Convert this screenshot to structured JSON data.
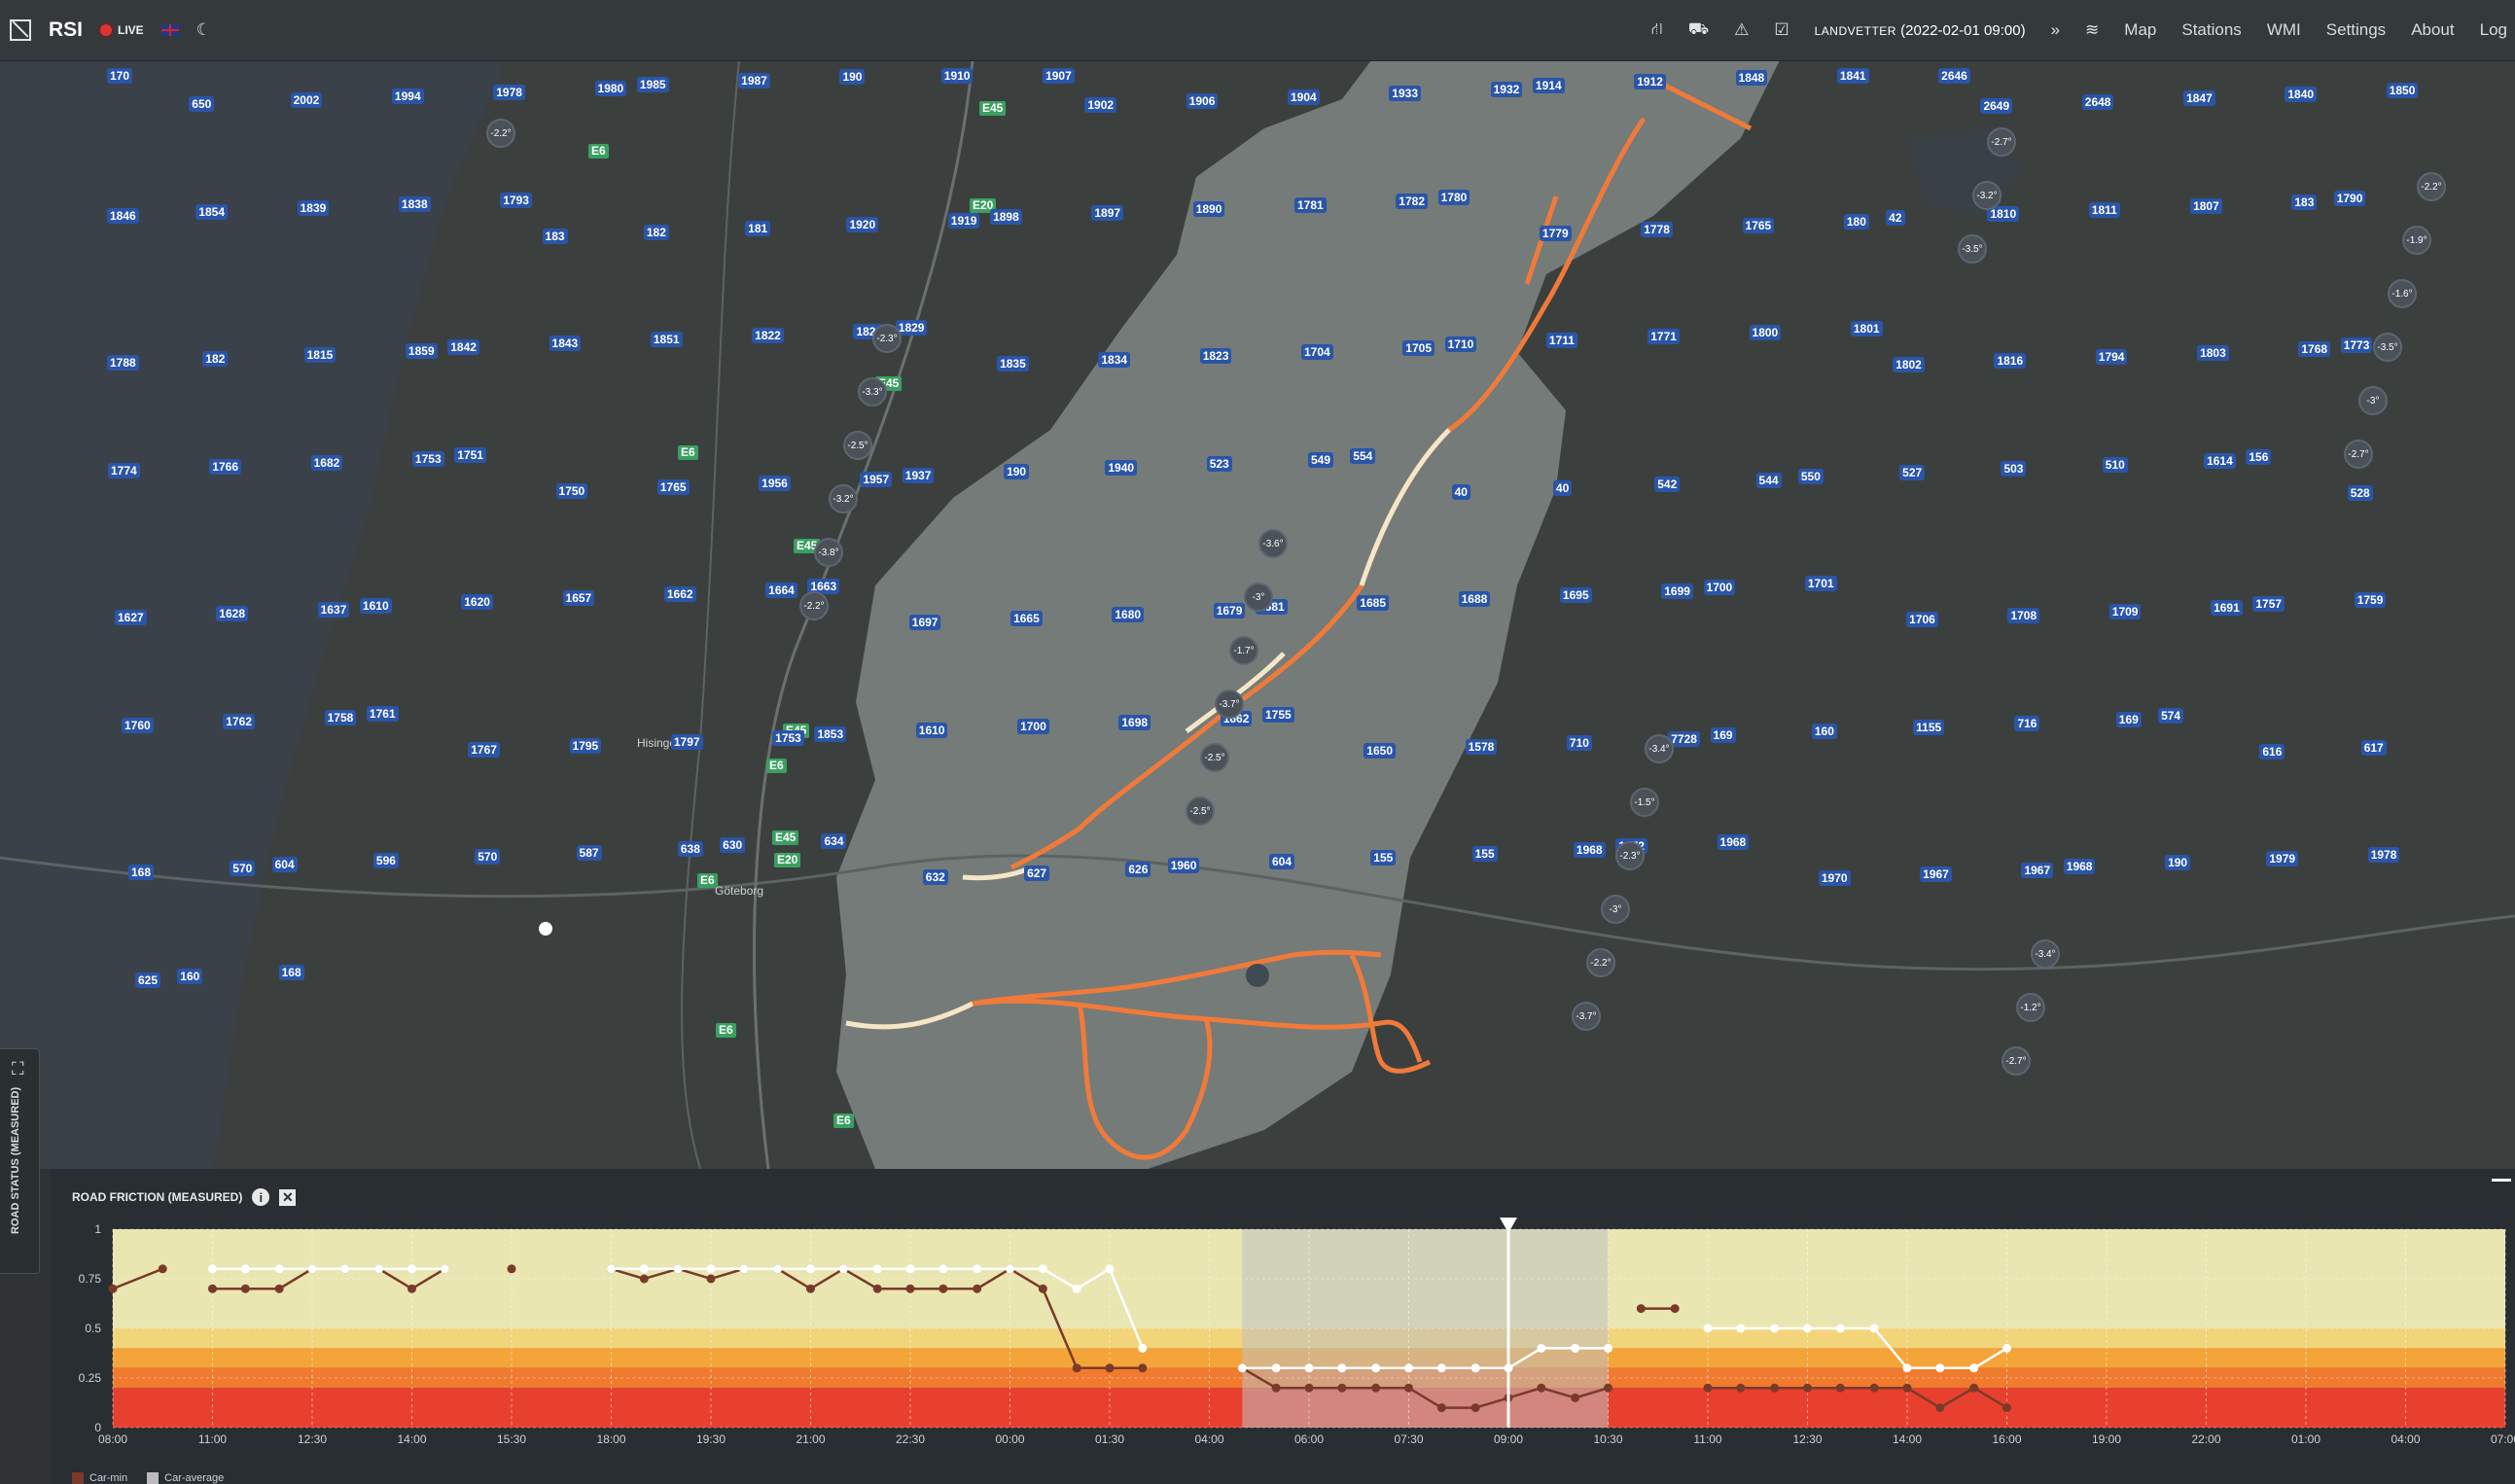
{
  "app": {
    "logo": "RSI",
    "live_label": "LIVE",
    "language": "English",
    "station": "LANDVETTER",
    "datetime": "(2022-02-01 09:00)",
    "nav": [
      "Map",
      "Stations",
      "WMI",
      "Settings",
      "About",
      "Log"
    ]
  },
  "icons": {
    "theme": "moon-icon",
    "road": "road-icon",
    "car": "car-icon",
    "warning": "warning-icon",
    "calendar": "calendar-icon",
    "forward": "chevrons-right-icon",
    "layers": "layers-icon"
  },
  "map": {
    "places": [
      "Hisingen",
      "Göteborg"
    ],
    "roads": [
      "E45",
      "E6",
      "E20",
      "E45",
      "E6",
      "E45",
      "E45",
      "E6",
      "E6",
      "E45",
      "E20",
      "E6",
      "E6"
    ],
    "station_labels": [
      "170",
      "650",
      "2002",
      "1994",
      "1978",
      "1980",
      "1985",
      "1987",
      "190",
      "1910",
      "1907",
      "1902",
      "1906",
      "1904",
      "1933",
      "1932",
      "1914",
      "1912",
      "1848",
      "1841",
      "2646",
      "2649",
      "2648",
      "1847",
      "1840",
      "1850",
      "1846",
      "1854",
      "1839",
      "1838",
      "1793",
      "183",
      "182",
      "181",
      "1920",
      "1919",
      "1898",
      "1897",
      "1890",
      "1781",
      "1782",
      "1780",
      "1779",
      "1778",
      "1765",
      "180",
      "42",
      "1810",
      "1811",
      "1807",
      "183",
      "1790",
      "1788",
      "182",
      "1815",
      "1859",
      "1842",
      "1843",
      "1851",
      "1822",
      "1824",
      "1829",
      "1835",
      "1834",
      "1823",
      "1704",
      "1705",
      "1710",
      "1711",
      "1771",
      "1800",
      "1801",
      "1802",
      "1816",
      "1794",
      "1803",
      "1768",
      "1773",
      "1774",
      "1766",
      "1682",
      "1753",
      "1751",
      "1750",
      "1765",
      "1956",
      "1957",
      "1937",
      "190",
      "1940",
      "523",
      "549",
      "554",
      "40",
      "40",
      "542",
      "544",
      "550",
      "527",
      "503",
      "510",
      "1614",
      "156",
      "528",
      "1627",
      "1628",
      "1637",
      "1610",
      "1620",
      "1657",
      "1662",
      "1664",
      "1663",
      "1697",
      "1665",
      "1680",
      "1679",
      "1681",
      "1685",
      "1688",
      "1695",
      "1699",
      "1700",
      "1701",
      "1706",
      "1708",
      "1709",
      "1691",
      "1757",
      "1759",
      "1760",
      "1762",
      "1758",
      "1761",
      "1767",
      "1795",
      "1797",
      "1753",
      "1853",
      "1610",
      "1700",
      "1698",
      "1662",
      "1755",
      "1650",
      "1578",
      "710",
      "7728",
      "169",
      "160",
      "1155",
      "716",
      "169",
      "574",
      "616",
      "617",
      "168",
      "570",
      "604",
      "596",
      "570",
      "587",
      "638",
      "630",
      "634",
      "632",
      "627",
      "626",
      "1960",
      "604",
      "155",
      "155",
      "1968",
      "1972",
      "1968",
      "1970",
      "1967",
      "1967",
      "1968",
      "190",
      "1979",
      "1978",
      "625",
      "160",
      "168"
    ],
    "temperatures": [
      "-2.2°",
      "-2.3°",
      "-3.6°",
      "-3.4°",
      "-3.4°",
      "-2.2°",
      "-3.3°",
      "-3°",
      "-1.5°",
      "-1.2°",
      "-1.9°",
      "-2.5°",
      "-1.7°",
      "-2.3°",
      "-2.7°",
      "-1.6°",
      "-3.2°",
      "-3.7°",
      "-3°",
      "-2.7°",
      "-3.5°",
      "-3.8°",
      "-2.5°",
      "-2.2°",
      "-3.2°",
      "-3°",
      "-2.2°",
      "-2.5°",
      "-3.7°",
      "-3.5°",
      "-2.7°"
    ]
  },
  "side_panel": {
    "label": "ROAD STATUS (MEASURED)"
  },
  "chart_panel": {
    "title": "ROAD FRICTION (MEASURED)",
    "legend": [
      "Car-min",
      "Car-average"
    ]
  },
  "chart_data": {
    "type": "line",
    "title": "ROAD FRICTION (MEASURED)",
    "x_ticks": [
      "08:00",
      "11:00",
      "12:30",
      "14:00",
      "15:30",
      "18:00",
      "19:30",
      "21:00",
      "22:30",
      "00:00",
      "01:30",
      "04:00",
      "06:00",
      "07:30",
      "09:00",
      "10:30",
      "11:00",
      "12:30",
      "14:00",
      "16:00",
      "19:00",
      "22:00",
      "01:00",
      "04:00",
      "07:00"
    ],
    "y_ticks": [
      "0",
      "0.25",
      "0.5",
      "0.75",
      "1"
    ],
    "ylim": [
      0,
      1
    ],
    "bands": [
      {
        "from": 0,
        "to": 0.2,
        "color": "#e8402e"
      },
      {
        "from": 0.2,
        "to": 0.3,
        "color": "#f07a2e"
      },
      {
        "from": 0.3,
        "to": 0.4,
        "color": "#f5a43a"
      },
      {
        "from": 0.4,
        "to": 0.5,
        "color": "#f2d47a"
      },
      {
        "from": 0.5,
        "to": 1.0,
        "color": "#e9e6b2"
      }
    ],
    "cursor_index": 14,
    "series": [
      {
        "name": "Car-min",
        "color": "#7a3a2a",
        "segments": [
          [
            [
              0,
              0.7
            ],
            [
              0.5,
              0.8
            ]
          ],
          [
            [
              1,
              0.7
            ],
            [
              1.33,
              0.7
            ],
            [
              1.67,
              0.7
            ],
            [
              2,
              0.8
            ],
            [
              2.33,
              0.8
            ],
            [
              2.67,
              0.8
            ],
            [
              3,
              0.7
            ],
            [
              3.33,
              0.8
            ]
          ],
          [
            [
              4,
              0.8
            ]
          ],
          [
            [
              5,
              0.8
            ],
            [
              5.33,
              0.75
            ],
            [
              5.67,
              0.8
            ],
            [
              6,
              0.75
            ],
            [
              6.33,
              0.8
            ],
            [
              6.67,
              0.8
            ],
            [
              7,
              0.7
            ],
            [
              7.33,
              0.8
            ],
            [
              7.67,
              0.7
            ],
            [
              8,
              0.7
            ],
            [
              8.33,
              0.7
            ],
            [
              8.67,
              0.7
            ],
            [
              9,
              0.8
            ],
            [
              9.33,
              0.7
            ],
            [
              9.67,
              0.3
            ],
            [
              10,
              0.3
            ],
            [
              10.33,
              0.3
            ]
          ],
          [
            [
              11.33,
              0.3
            ],
            [
              11.67,
              0.2
            ],
            [
              12,
              0.2
            ],
            [
              12.33,
              0.2
            ],
            [
              12.67,
              0.2
            ],
            [
              13,
              0.2
            ],
            [
              13.33,
              0.1
            ],
            [
              13.67,
              0.1
            ],
            [
              14,
              0.15
            ],
            [
              14.33,
              0.2
            ],
            [
              14.67,
              0.15
            ],
            [
              15,
              0.2
            ]
          ],
          [
            [
              15.33,
              0.6
            ],
            [
              15.67,
              0.6
            ]
          ],
          [
            [
              16,
              0.2
            ],
            [
              16.33,
              0.2
            ],
            [
              16.67,
              0.2
            ],
            [
              17,
              0.2
            ],
            [
              17.33,
              0.2
            ],
            [
              17.67,
              0.2
            ],
            [
              18,
              0.2
            ],
            [
              18.33,
              0.1
            ],
            [
              18.67,
              0.2
            ],
            [
              19,
              0.1
            ]
          ]
        ]
      },
      {
        "name": "Car-average",
        "color": "#ffffff",
        "segments": [
          [
            [
              1,
              0.8
            ],
            [
              1.33,
              0.8
            ],
            [
              1.67,
              0.8
            ],
            [
              2,
              0.8
            ],
            [
              2.33,
              0.8
            ],
            [
              2.67,
              0.8
            ],
            [
              3,
              0.8
            ],
            [
              3.33,
              0.8
            ]
          ],
          [
            [
              5,
              0.8
            ],
            [
              5.33,
              0.8
            ],
            [
              5.67,
              0.8
            ],
            [
              6,
              0.8
            ],
            [
              6.33,
              0.8
            ],
            [
              6.67,
              0.8
            ],
            [
              7,
              0.8
            ],
            [
              7.33,
              0.8
            ],
            [
              7.67,
              0.8
            ],
            [
              8,
              0.8
            ],
            [
              8.33,
              0.8
            ],
            [
              8.67,
              0.8
            ],
            [
              9,
              0.8
            ],
            [
              9.33,
              0.8
            ],
            [
              9.67,
              0.7
            ],
            [
              10,
              0.8
            ],
            [
              10.33,
              0.4
            ]
          ],
          [
            [
              11.33,
              0.3
            ],
            [
              11.67,
              0.3
            ],
            [
              12,
              0.3
            ],
            [
              12.33,
              0.3
            ],
            [
              12.67,
              0.3
            ],
            [
              13,
              0.3
            ],
            [
              13.33,
              0.3
            ],
            [
              13.67,
              0.3
            ],
            [
              14,
              0.3
            ],
            [
              14.33,
              0.4
            ],
            [
              14.67,
              0.4
            ],
            [
              15,
              0.4
            ]
          ],
          [
            [
              16,
              0.5
            ],
            [
              16.33,
              0.5
            ],
            [
              16.67,
              0.5
            ],
            [
              17,
              0.5
            ],
            [
              17.33,
              0.5
            ],
            [
              17.67,
              0.5
            ],
            [
              18,
              0.3
            ],
            [
              18.33,
              0.3
            ],
            [
              18.67,
              0.3
            ],
            [
              19,
              0.4
            ]
          ]
        ]
      }
    ],
    "highlight_range": [
      11.33,
      15
    ]
  }
}
